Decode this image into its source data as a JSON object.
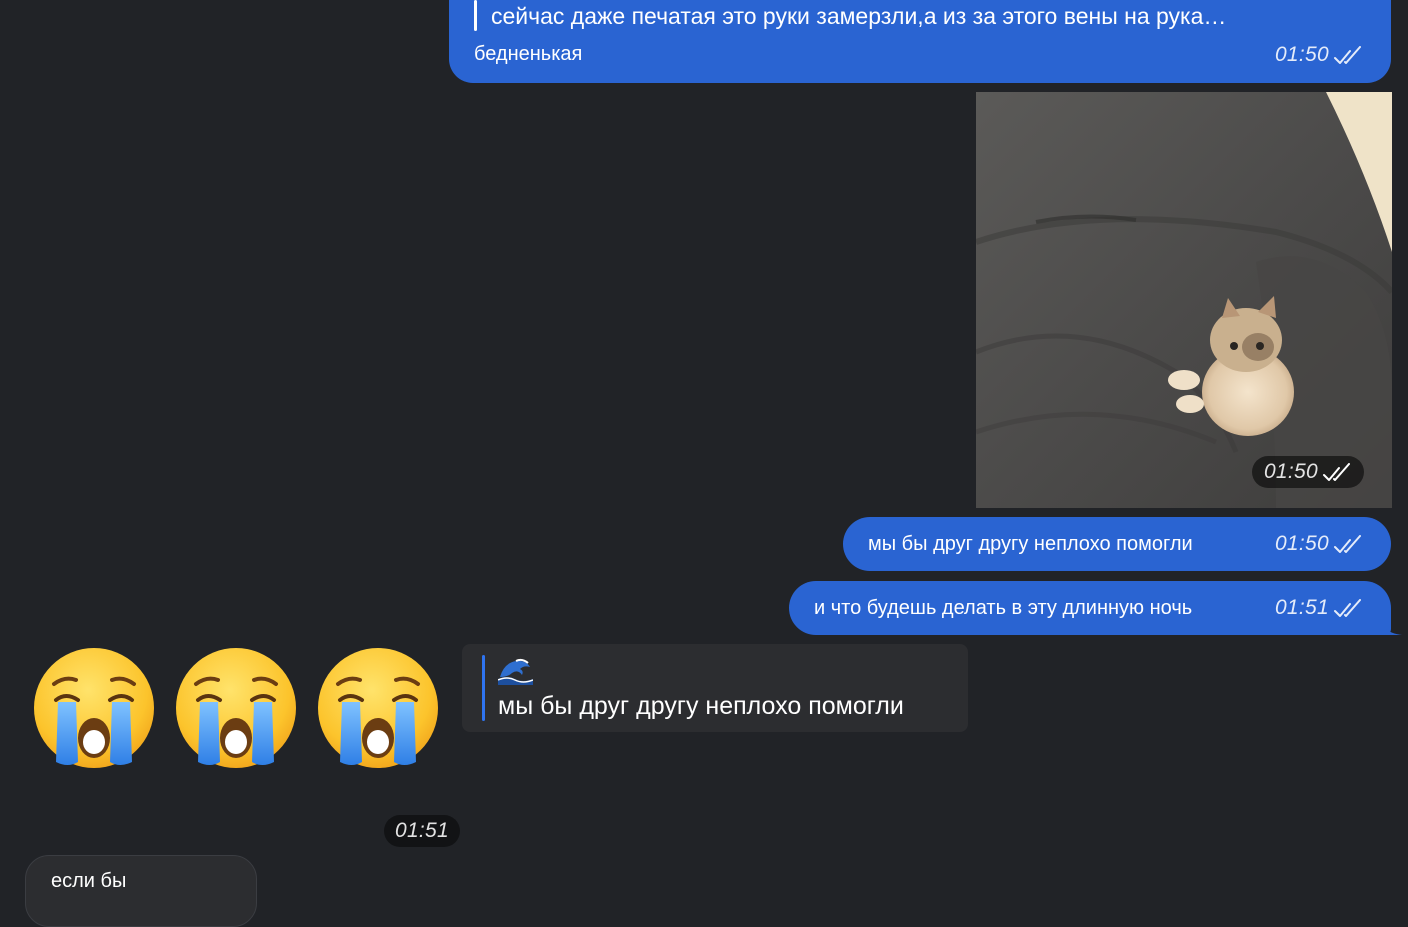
{
  "colors": {
    "background": "#212327",
    "outgoing_bubble": "#2a64d2",
    "incoming_bubble": "#2c2d30",
    "reply_bar_incoming": "#2f74f0"
  },
  "messages": {
    "m1": {
      "quote": "сейчас даже печатая это руки замерзли,а из за этого вены на рука…",
      "text": "бедненькая",
      "time": "01:50",
      "status_icon": "double-check-icon"
    },
    "photo": {
      "time": "01:50",
      "status_icon": "double-check-icon"
    },
    "m3": {
      "text": "мы бы друг другу неплохо помогли",
      "time": "01:50",
      "status_icon": "double-check-icon"
    },
    "m4": {
      "text": "и что будешь делать в эту длинную ночь",
      "time": "01:51",
      "status_icon": "double-check-icon"
    },
    "incoming_emoji": {
      "emojis": [
        "loudly-crying-face-icon",
        "loudly-crying-face-icon",
        "loudly-crying-face-icon"
      ],
      "reply_icon": "great-wave-icon",
      "reply_text": "мы бы друг другу неплохо помогли",
      "time": "01:51"
    },
    "m5": {
      "text": "если бы"
    }
  }
}
